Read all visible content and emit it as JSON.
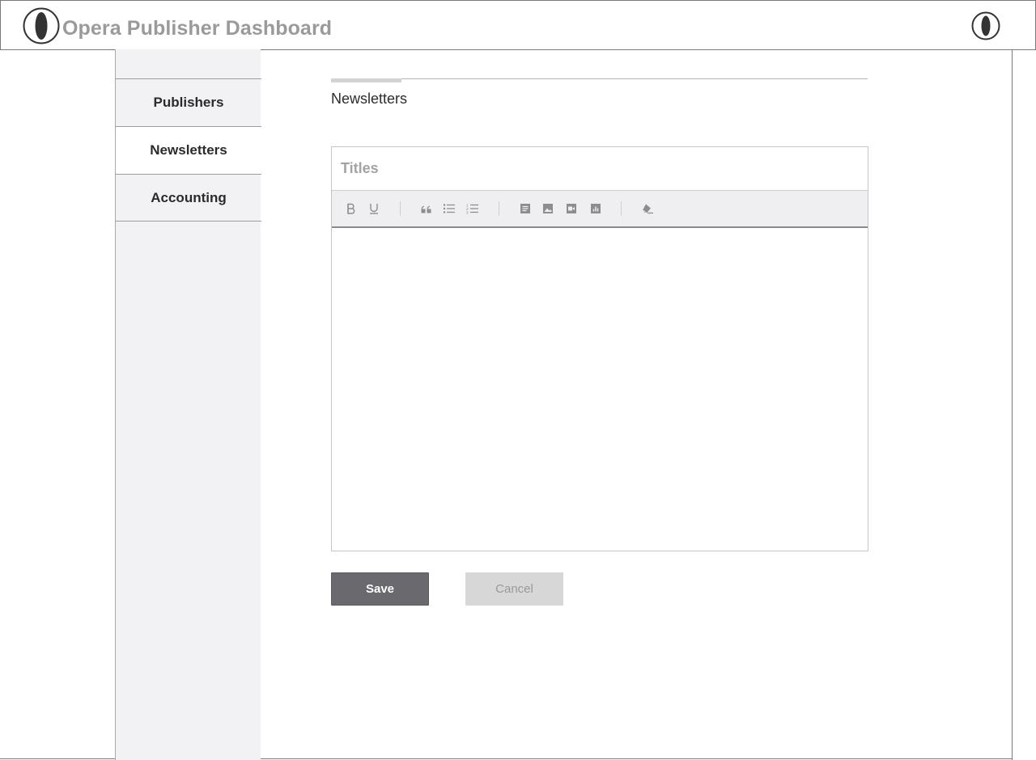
{
  "header": {
    "title": "Opera Publisher Dashboard",
    "logo_icon": "opera-logo-icon",
    "user_icon": "opera-logo-icon"
  },
  "sidebar": {
    "items": [
      {
        "label": "Publishers",
        "active": false
      },
      {
        "label": "Newsletters",
        "active": true
      },
      {
        "label": "Accounting",
        "active": false
      }
    ]
  },
  "main": {
    "tab_label": "Newsletters",
    "editor": {
      "title_placeholder": "Titles",
      "title_value": "",
      "toolbar": [
        "bold-icon",
        "underline-icon",
        "quote-icon",
        "bullet-list-icon",
        "numbered-list-icon",
        "document-icon",
        "image-icon",
        "video-icon",
        "chart-icon",
        "clear-format-icon"
      ]
    },
    "buttons": {
      "save_label": "Save",
      "cancel_label": "Cancel"
    }
  },
  "colors": {
    "primary_button": "#6a696d",
    "secondary_button": "#d7d7d8",
    "sidebar_bg": "#f2f1f3",
    "title_text": "#9a9a9a"
  }
}
